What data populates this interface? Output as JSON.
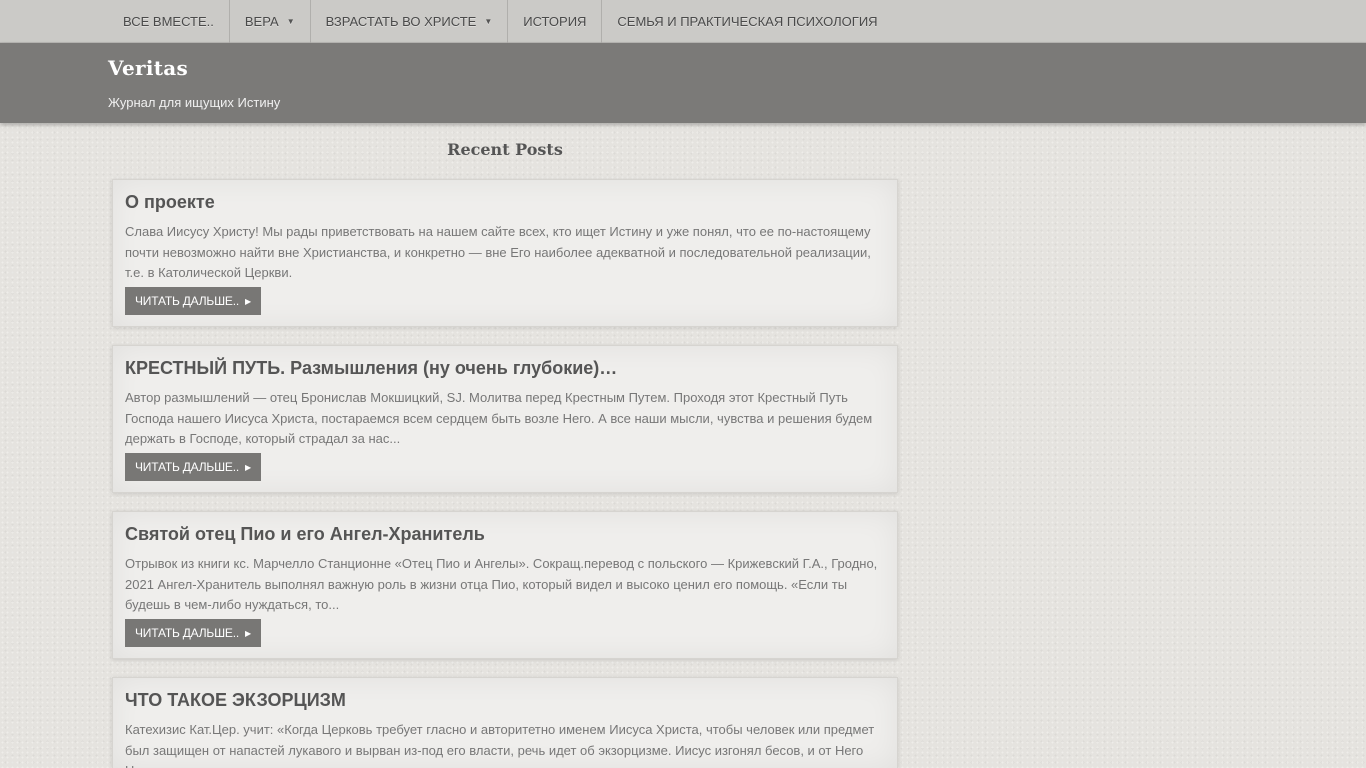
{
  "nav": {
    "items": [
      {
        "label": "ВСЕ ВМЕСТЕ..",
        "has_dropdown": false
      },
      {
        "label": "ВЕРА",
        "has_dropdown": true
      },
      {
        "label": "ВЗРАСТАТЬ ВО ХРИСТЕ",
        "has_dropdown": true
      },
      {
        "label": "ИСТОРИЯ",
        "has_dropdown": false
      },
      {
        "label": "СЕМЬЯ И ПРАКТИЧЕСКАЯ ПСИХОЛОГИЯ",
        "has_dropdown": false
      }
    ]
  },
  "header": {
    "title": "Veritas",
    "description": "Журнал для ищущих Истину"
  },
  "main": {
    "section_title": "Recent Posts",
    "read_more_label": "ЧИТАТЬ ДАЛЬШЕ..",
    "posts": [
      {
        "title": "О проекте",
        "excerpt": "Слава  Иисусу  Христу! Мы рады приветствовать на нашем сайте всех, кто ищет Истину и уже понял, что ее по-настоящему почти невозможно найти вне Христианства, и конкретно — вне Его наиболее адекватной и последовательной реализации, т.е. в Католической Церкви."
      },
      {
        "title": "КРЕСТНЫЙ ПУТЬ. Размышления (ну очень глубокие)…",
        "excerpt": "Автор размышлений — отец Бронислав Мокшицкий, SJ. Молитва перед Крестным Путем. Проходя этот Крестный Путь Господа нашего Иисуса Христа, постараемся всем сердцем быть возле Него. А все наши мысли, чувства и решения будем держать в Господе, который страдал за нас..."
      },
      {
        "title": "Святой отец Пио и его Ангел-Хранитель",
        "excerpt": "Отрывок из книги кс. Марчелло Станционне «Отец Пио и Ангелы». Сокращ.перевод с польского — Крижевский Г.А., Гродно, 2021 Ангел-Хранитель выполнял важную роль в жизни отца Пио, который видел и высоко ценил его помощь. «Если ты будешь в чем-либо нуждаться, то..."
      },
      {
        "title": "ЧТО ТАКОЕ ЭКЗОРЦИЗМ",
        "excerpt": "Катехизис Кат.Цер. учит: «Когда Церковь требует гласно и авторитетно именем Иисуса Христа, чтобы человек или предмет был защищен от напастей лукавого и вырван из-под его власти, речь идет об экзорцизме. Иисус изгонял бесов, и от Него Церковь получила власть и..."
      }
    ]
  }
}
